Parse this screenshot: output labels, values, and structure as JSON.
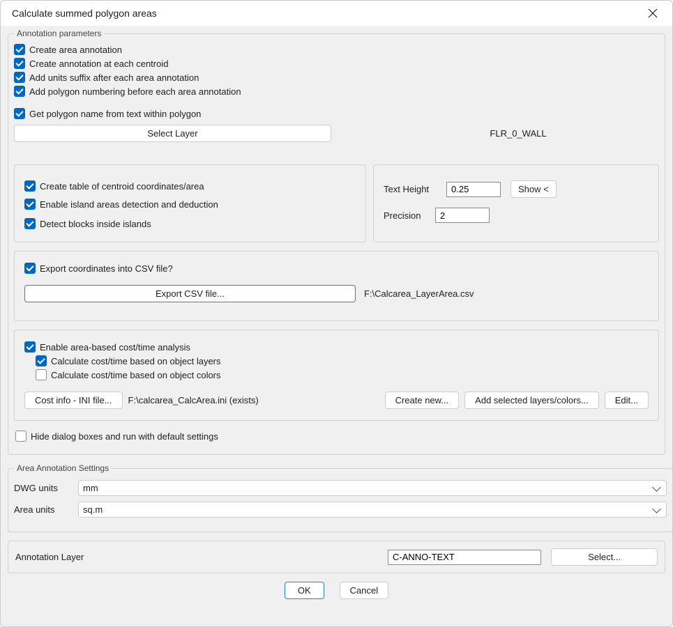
{
  "window": {
    "title": "Calculate summed polygon areas"
  },
  "annotation_params": {
    "legend": "Annotation parameters",
    "create_area_annotation": "Create area annotation",
    "create_at_centroid": "Create annotation at each centroid",
    "add_units_suffix": "Add units suffix after each area annotation",
    "add_polygon_numbering": "Add polygon numbering before each area annotation",
    "get_polygon_name": "Get polygon name from text within polygon",
    "select_layer_btn": "Select Layer",
    "selected_layer": "FLR_0_WALL"
  },
  "table_panel": {
    "create_table": "Create table of centroid coordinates/area",
    "enable_island": "Enable island areas detection and deduction",
    "detect_blocks": "Detect blocks inside islands"
  },
  "text_panel": {
    "text_height_label": "Text Height",
    "text_height_value": "0.25",
    "show_btn": "Show <",
    "precision_label": "Precision",
    "precision_value": "2"
  },
  "csv_panel": {
    "export_question": "Export coordinates into CSV file?",
    "export_btn": "Export CSV file...",
    "csv_path": "F:\\Calcarea_LayerArea.csv"
  },
  "cost_panel": {
    "enable_cost": "Enable area-based cost/time analysis",
    "calc_by_layers": "Calculate cost/time based on object layers",
    "calc_by_colors": "Calculate cost/time based on object colors",
    "ini_btn": "Cost info - INI file...",
    "ini_path": "F:\\calcarea_CalcArea.ini (exists)",
    "create_new_btn": "Create new...",
    "add_selected_btn": "Add selected layers/colors...",
    "edit_btn": "Edit..."
  },
  "hide_dialog": "Hide dialog boxes and run with default settings",
  "area_settings": {
    "legend": "Area Annotation Settings",
    "dwg_units_label": "DWG units",
    "dwg_units_value": "mm",
    "area_units_label": "Area units",
    "area_units_value": "sq.m"
  },
  "annotation_layer": {
    "label": "Annotation Layer",
    "value": "C-ANNO-TEXT",
    "select_btn": "Select..."
  },
  "footer": {
    "ok": "OK",
    "cancel": "Cancel"
  }
}
